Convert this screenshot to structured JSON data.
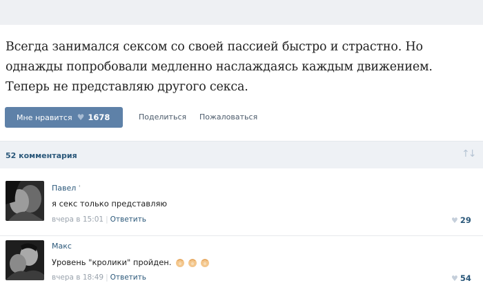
{
  "post": {
    "text": "Всегда занимался сексом со своей пассией быстро и страстно. Но однажды попробовали медленно наслаждаясь каждым движением. Теперь не представляю другого секса."
  },
  "actions": {
    "like_label": "Мне нравится",
    "like_count": "1678",
    "share_label": "Поделиться",
    "report_label": "Пожаловаться"
  },
  "comments_header": {
    "count_label": "52 комментария",
    "sort_icon": "sort-arrows-icon"
  },
  "comments": [
    {
      "author": "Павел",
      "author_mark": "'",
      "text": "я секс только представляю",
      "emoji": "",
      "date": "вчера в 15:01",
      "reply_label": "Ответить",
      "likes": "29"
    },
    {
      "author": "Макс",
      "author_mark": "",
      "text": "Уровень \"кролики\" пройден.",
      "emoji": "clapping-hands-icon x3",
      "date": "вчера в 18:49",
      "reply_label": "Ответить",
      "likes": "54"
    }
  ],
  "colors": {
    "like_button": "#5e81a8",
    "link": "#2b587a",
    "comments_bar": "#eef1f5"
  }
}
